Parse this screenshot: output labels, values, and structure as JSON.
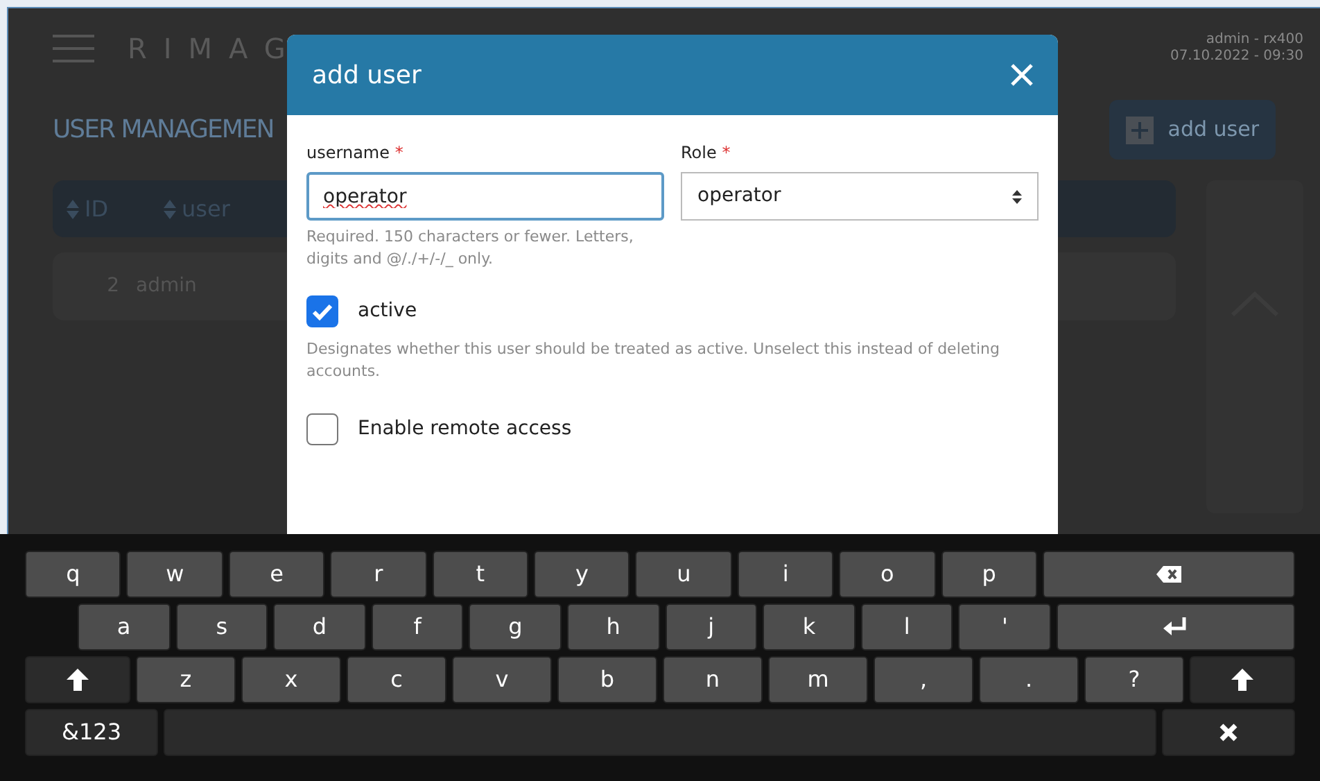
{
  "app": {
    "logo": "RIMAG",
    "user_info": "admin - rx400",
    "datetime": "07.10.2022 - 09:30",
    "page_title": "USER MANAGEMEN",
    "add_button": "add user",
    "table": {
      "columns": [
        "ID",
        "user"
      ],
      "rows": [
        {
          "id": "2",
          "user": "admin"
        }
      ]
    }
  },
  "dialog": {
    "title": "add user",
    "username": {
      "label": "username",
      "required": "*",
      "value": "operator",
      "help": "Required. 150 characters or fewer. Letters, digits and @/./+/-/_ only."
    },
    "role": {
      "label": "Role",
      "required": "*",
      "value": "operator"
    },
    "checkboxes": [
      {
        "label": "active",
        "checked": true,
        "help": "Designates whether this user should be treated as active. Unselect this instead of deleting accounts."
      },
      {
        "label": "Enable remote access",
        "checked": false
      }
    ]
  },
  "keyboard": {
    "rows": [
      [
        {
          "kind": "char",
          "label": "q"
        },
        {
          "kind": "char",
          "label": "w"
        },
        {
          "kind": "char",
          "label": "e"
        },
        {
          "kind": "char",
          "label": "r"
        },
        {
          "kind": "char",
          "label": "t"
        },
        {
          "kind": "char",
          "label": "y"
        },
        {
          "kind": "char",
          "label": "u"
        },
        {
          "kind": "char",
          "label": "i"
        },
        {
          "kind": "char",
          "label": "o"
        },
        {
          "kind": "char",
          "label": "p"
        },
        {
          "kind": "backspace"
        }
      ],
      [
        {
          "kind": "char",
          "label": "a"
        },
        {
          "kind": "char",
          "label": "s"
        },
        {
          "kind": "char",
          "label": "d"
        },
        {
          "kind": "char",
          "label": "f"
        },
        {
          "kind": "char",
          "label": "g"
        },
        {
          "kind": "char",
          "label": "h"
        },
        {
          "kind": "char",
          "label": "j"
        },
        {
          "kind": "char",
          "label": "k"
        },
        {
          "kind": "char",
          "label": "l"
        },
        {
          "kind": "char",
          "label": "'"
        },
        {
          "kind": "enter"
        }
      ],
      [
        {
          "kind": "shift"
        },
        {
          "kind": "char",
          "label": "z"
        },
        {
          "kind": "char",
          "label": "x"
        },
        {
          "kind": "char",
          "label": "c"
        },
        {
          "kind": "char",
          "label": "v"
        },
        {
          "kind": "char",
          "label": "b"
        },
        {
          "kind": "char",
          "label": "n"
        },
        {
          "kind": "char",
          "label": "m"
        },
        {
          "kind": "char",
          "label": ","
        },
        {
          "kind": "char",
          "label": "."
        },
        {
          "kind": "char",
          "label": "?"
        },
        {
          "kind": "shift"
        }
      ],
      [
        {
          "kind": "mode",
          "label": "&123"
        },
        {
          "kind": "space"
        },
        {
          "kind": "close"
        }
      ]
    ]
  }
}
